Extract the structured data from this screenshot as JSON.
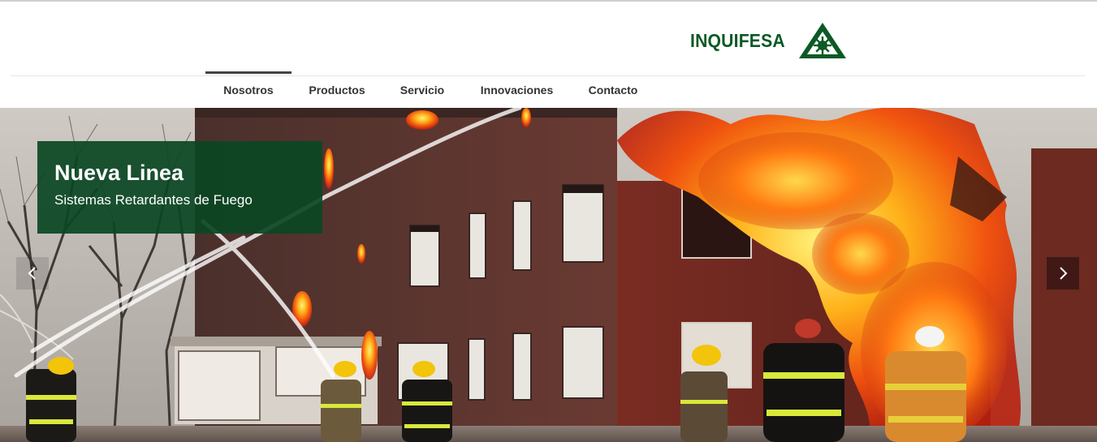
{
  "brand": {
    "name": "INQUIFESA",
    "color": "#0b5a25"
  },
  "nav": {
    "items": [
      {
        "label": "Nosotros",
        "active": true
      },
      {
        "label": "Productos",
        "active": false
      },
      {
        "label": "Servicio",
        "active": false
      },
      {
        "label": "Innovaciones",
        "active": false
      },
      {
        "label": "Contacto",
        "active": false
      }
    ]
  },
  "slider": {
    "caption": {
      "title": "Nueva Linea",
      "subtitle": "Sistemas Retardantes de Fuego"
    },
    "prev_icon": "chevron-left-icon",
    "next_icon": "chevron-right-icon",
    "image": "firefighters-spraying-burning-building"
  }
}
